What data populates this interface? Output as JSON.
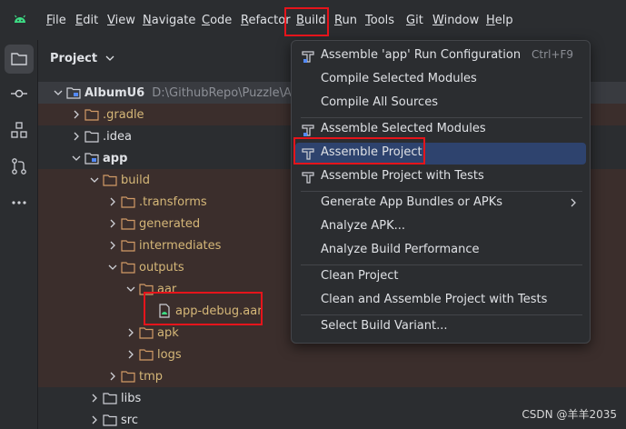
{
  "menubar": {
    "items": [
      {
        "mnemonic": "F",
        "rest": "ile"
      },
      {
        "mnemonic": "E",
        "rest": "dit"
      },
      {
        "mnemonic": "V",
        "rest": "iew"
      },
      {
        "mnemonic": "N",
        "rest": "avigate"
      },
      {
        "mnemonic": "C",
        "rest": "ode"
      },
      {
        "mnemonic": "R",
        "rest": "efactor"
      },
      {
        "mnemonic": "B",
        "rest": "uild"
      },
      {
        "mnemonic": "R",
        "rest": "un"
      },
      {
        "mnemonic": "T",
        "rest": "ools"
      },
      {
        "mnemonic": "G",
        "rest": "it"
      },
      {
        "mnemonic": "W",
        "rest": "indow"
      },
      {
        "mnemonic": "H",
        "rest": "elp"
      }
    ]
  },
  "sidebar": {
    "items": [
      "folder-icon",
      "commit-icon",
      "structure-icon",
      "pull-requests-icon",
      "more-icon"
    ]
  },
  "project_panel": {
    "title": "Project",
    "tree": [
      {
        "label": "AlbumU6",
        "path": "D:\\GithubRepo\\Puzzle\\Albun",
        "icon": "module-folder-icon"
      },
      {
        "label": ".gradle",
        "icon": "folder-icon"
      },
      {
        "label": ".idea",
        "icon": "folder-icon"
      },
      {
        "label": "app",
        "icon": "module-folder-icon"
      },
      {
        "label": "build",
        "icon": "folder-icon"
      },
      {
        "label": ".transforms",
        "icon": "folder-icon"
      },
      {
        "label": "generated",
        "icon": "folder-icon"
      },
      {
        "label": "intermediates",
        "icon": "folder-icon"
      },
      {
        "label": "outputs",
        "icon": "folder-icon"
      },
      {
        "label": "aar",
        "icon": "folder-icon"
      },
      {
        "label": "app-debug.aar",
        "icon": "file-icon"
      },
      {
        "label": "apk",
        "icon": "folder-icon"
      },
      {
        "label": "logs",
        "icon": "folder-icon"
      },
      {
        "label": "tmp",
        "icon": "folder-icon"
      },
      {
        "label": "libs",
        "icon": "folder-icon"
      },
      {
        "label": "src",
        "icon": "folder-icon"
      }
    ]
  },
  "build_menu": {
    "items": [
      {
        "label": "Assemble 'app' Run Configuration",
        "shortcut": "Ctrl+F9",
        "icon": "hammer-icon"
      },
      {
        "label": "Compile Selected Modules"
      },
      {
        "label": "Compile All Sources"
      },
      {
        "label": "Assemble Selected Modules",
        "icon": "hammer-icon"
      },
      {
        "label": "Assemble Project",
        "icon": "hammer-icon",
        "selected": true
      },
      {
        "label": "Assemble Project with Tests",
        "icon": "hammer-icon"
      },
      {
        "label": "Generate App Bundles or APKs",
        "submenu": true
      },
      {
        "label": "Analyze APK..."
      },
      {
        "label": "Analyze Build Performance"
      },
      {
        "label": "Clean Project"
      },
      {
        "label": "Clean and Assemble Project with Tests"
      },
      {
        "label": "Select Build Variant..."
      }
    ]
  },
  "watermark": "CSDN @羊羊2035",
  "colors": {
    "background": "#2b2d30",
    "selection": "#2e436e",
    "highlight_box": "#e5141b",
    "build_folder": "#d5b778"
  }
}
